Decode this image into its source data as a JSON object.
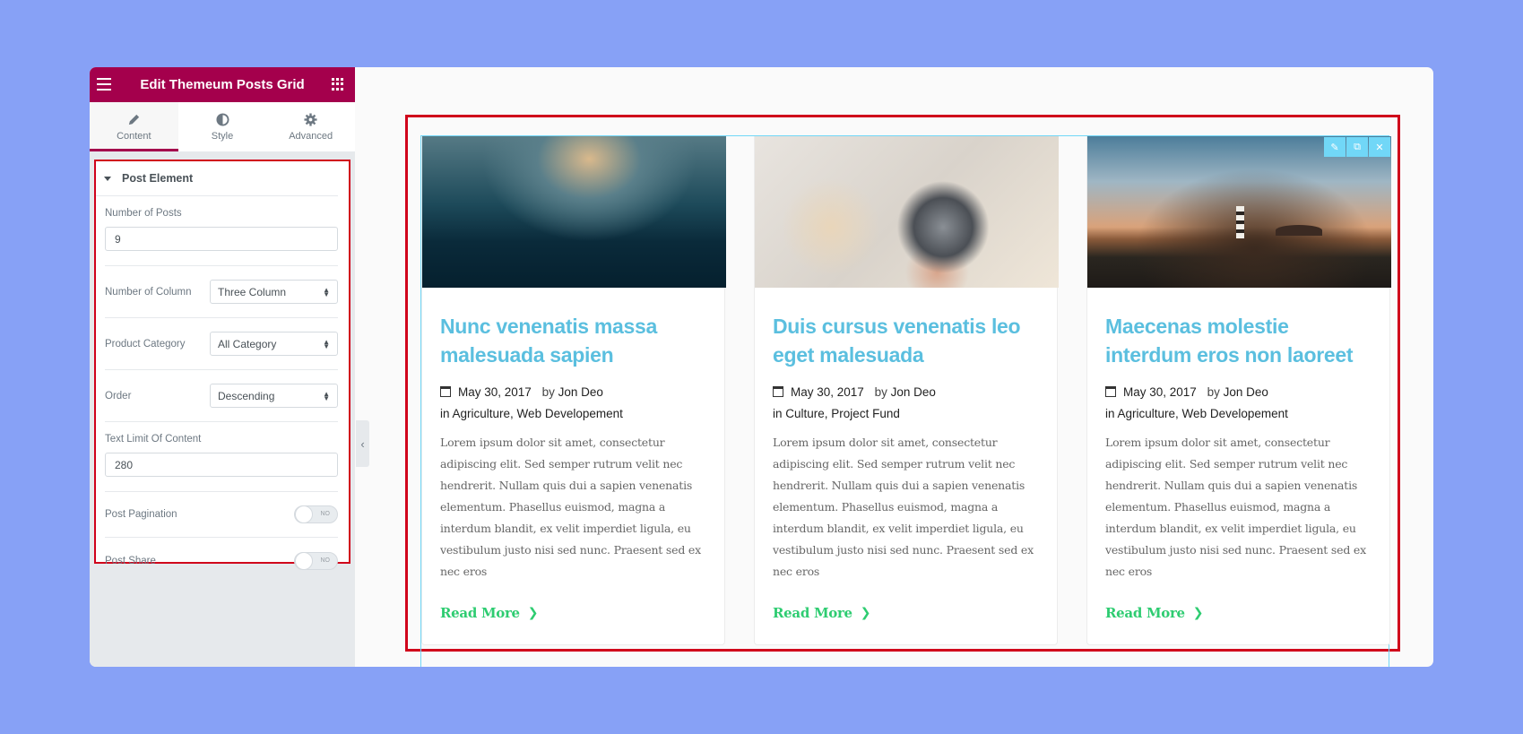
{
  "panel": {
    "title": "Edit Themeum Posts Grid",
    "tabs": [
      {
        "label": "Content",
        "icon": "pencil-icon",
        "active": true
      },
      {
        "label": "Style",
        "icon": "contrast-icon",
        "active": false
      },
      {
        "label": "Advanced",
        "icon": "gear-icon",
        "active": false
      }
    ],
    "section": {
      "title": "Post Element",
      "number_of_posts": {
        "label": "Number of Posts",
        "value": "9"
      },
      "number_of_column": {
        "label": "Number of Column",
        "value": "Three Column"
      },
      "product_category": {
        "label": "Product Category",
        "value": "All Category"
      },
      "order": {
        "label": "Order",
        "value": "Descending"
      },
      "text_limit": {
        "label": "Text Limit Of Content",
        "value": "280"
      },
      "post_pagination": {
        "label": "Post Pagination",
        "state": "NO"
      },
      "post_share": {
        "label": "Post Share",
        "state": "NO"
      }
    }
  },
  "colors": {
    "brand": "#a4004c",
    "highlight_border": "#d0021b",
    "title": "#5bbfdf",
    "read_more": "#2ecc71",
    "widget_tools": "#71d7f7",
    "background": "#87a1f6"
  },
  "posts": [
    {
      "title": "Nunc venenatis massa malesuada sapien",
      "date": "May 30, 2017",
      "by": "by",
      "author": "Jon Deo",
      "in": "in",
      "categories": "Agriculture, Web Developement",
      "excerpt": "Lorem ipsum dolor sit amet, consectetur adipiscing elit. Sed semper rutrum velit nec hendrerit. Nullam quis dui a sapien venenatis elementum. Phasellus euismod, magna a interdum blandit, ex velit imperdiet ligula, eu vestibulum justo nisi sed nunc. Praesent sed ex nec eros",
      "read_more": "Read More"
    },
    {
      "title": "Duis cursus venenatis leo eget malesuada",
      "date": "May 30, 2017",
      "by": "by",
      "author": "Jon Deo",
      "in": "in",
      "categories": "Culture, Project Fund",
      "excerpt": "Lorem ipsum dolor sit amet, consectetur adipiscing elit. Sed semper rutrum velit nec hendrerit. Nullam quis dui a sapien venenatis elementum. Phasellus euismod, magna a interdum blandit, ex velit imperdiet ligula, eu vestibulum justo nisi sed nunc. Praesent sed ex nec eros",
      "read_more": "Read More"
    },
    {
      "title": "Maecenas molestie interdum eros non laoreet",
      "date": "May 30, 2017",
      "by": "by",
      "author": "Jon Deo",
      "in": "in",
      "categories": "Agriculture, Web Developement",
      "excerpt": "Lorem ipsum dolor sit amet, consectetur adipiscing elit. Sed semper rutrum velit nec hendrerit. Nullam quis dui a sapien venenatis elementum. Phasellus euismod, magna a interdum blandit, ex velit imperdiet ligula, eu vestibulum justo nisi sed nunc. Praesent sed ex nec eros",
      "read_more": "Read More"
    }
  ],
  "widget_tools": [
    {
      "icon": "edit-icon",
      "glyph": "✎"
    },
    {
      "icon": "duplicate-icon",
      "glyph": "⧉"
    },
    {
      "icon": "close-icon",
      "glyph": "✕"
    }
  ]
}
